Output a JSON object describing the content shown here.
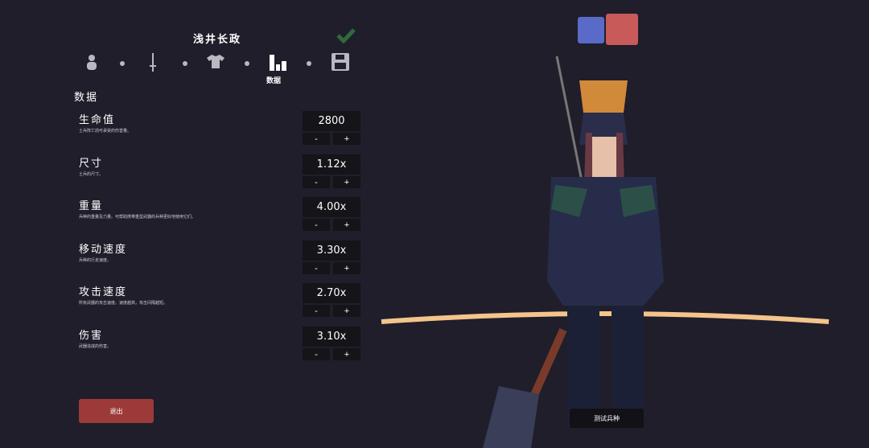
{
  "unit_name": "浅井长政",
  "steps": [
    {
      "icon": "person-icon"
    },
    {
      "icon": "sword-icon"
    },
    {
      "icon": "shirt-icon"
    },
    {
      "icon": "stats-icon",
      "label": "数据"
    },
    {
      "icon": "save-icon"
    }
  ],
  "section_title": "数据",
  "stats": [
    {
      "name": "生命值",
      "desc": "士兵阵亡前可承受的伤害量。",
      "value": "2800"
    },
    {
      "name": "尺寸",
      "desc": "士兵的尺寸。",
      "value": "1.12x"
    },
    {
      "name": "重量",
      "desc": "兵种的重量及力量。可帮助携带重型武器的兵种更好地使用它们。",
      "value": "4.00x"
    },
    {
      "name": "移动速度",
      "desc": "兵种的行走速度。",
      "value": "3.30x"
    },
    {
      "name": "攻击速度",
      "desc": "所有武器的攻击速度。速度越高，攻击间隔越短。",
      "value": "2.70x"
    },
    {
      "name": "伤害",
      "desc": "武器造成的伤害。",
      "value": "3.10x"
    }
  ],
  "minus_label": "-",
  "plus_label": "+",
  "exit_label": "退出",
  "test_label": "测试兵种",
  "colors": {
    "team_blue": "#5a6ac8",
    "team_red": "#c85a5a",
    "exit": "#9c3a3a"
  }
}
